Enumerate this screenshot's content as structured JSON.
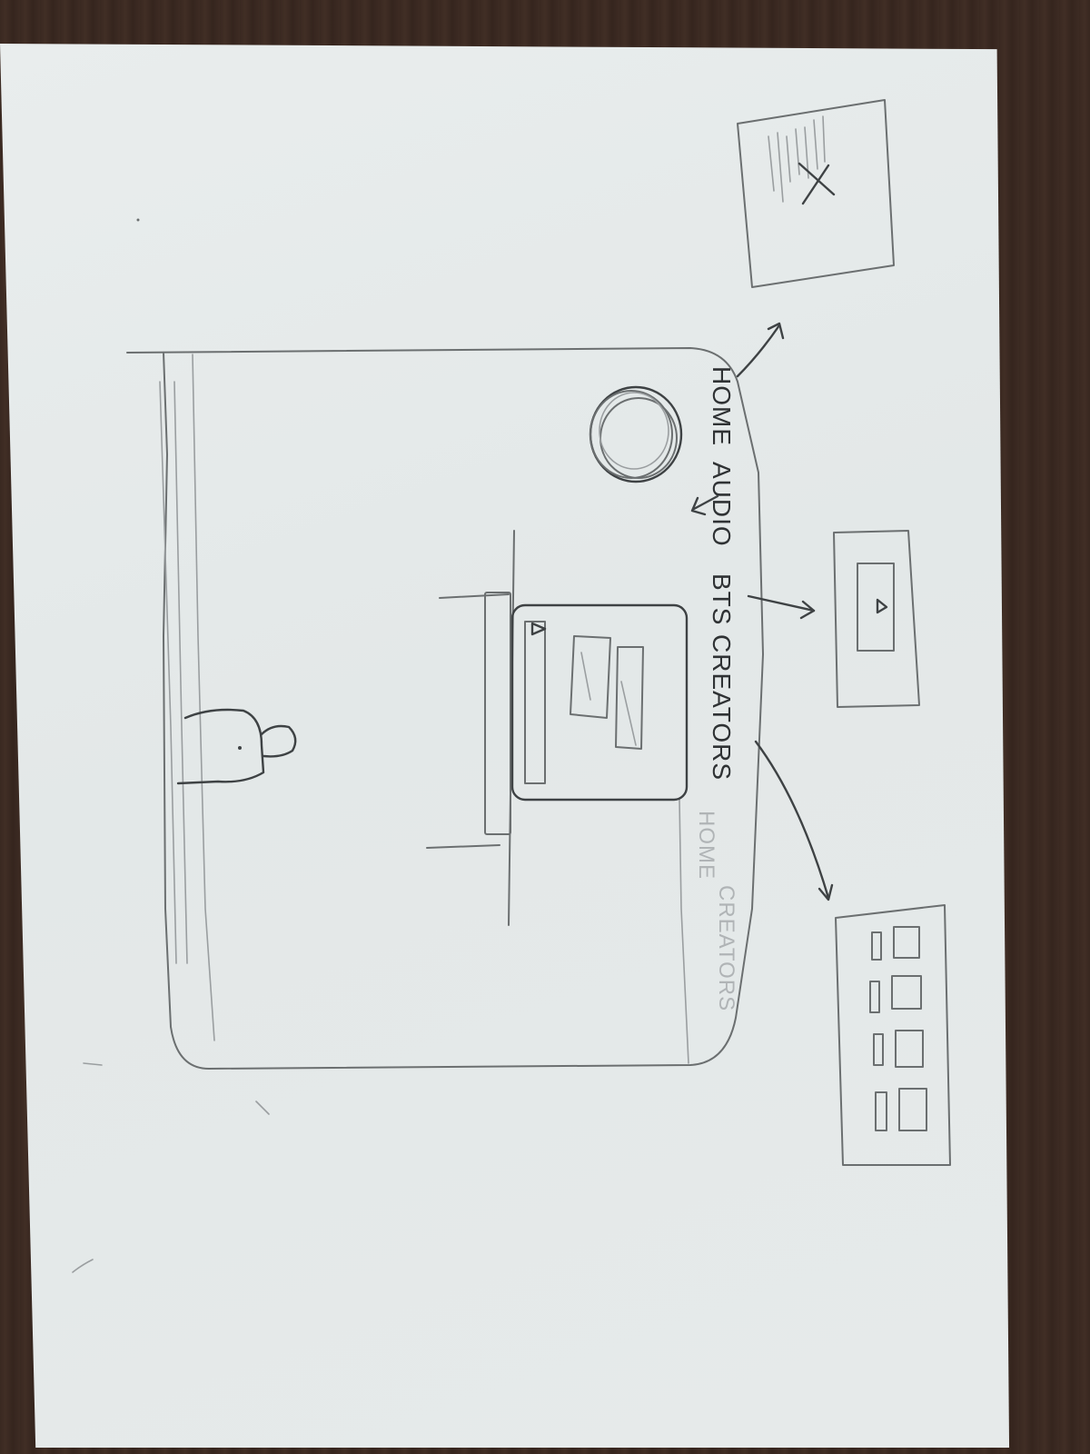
{
  "nav": {
    "items": [
      {
        "label": "HOME"
      },
      {
        "label": "AUDIO"
      },
      {
        "label": "BTS"
      },
      {
        "label": "CREATORS"
      }
    ],
    "ghost_items": [
      {
        "label": "HOME"
      },
      {
        "label": "CREATORS"
      }
    ]
  },
  "popups": {
    "home_panel": {
      "close_icon": "close-icon"
    },
    "bts_panel": {
      "play_icon": "play-icon"
    },
    "creators_panel": {
      "grid_rows": 4
    }
  },
  "colors": {
    "paper": "#e6eaea",
    "pencil": "#6b6f70",
    "table": "#3b2a22"
  }
}
